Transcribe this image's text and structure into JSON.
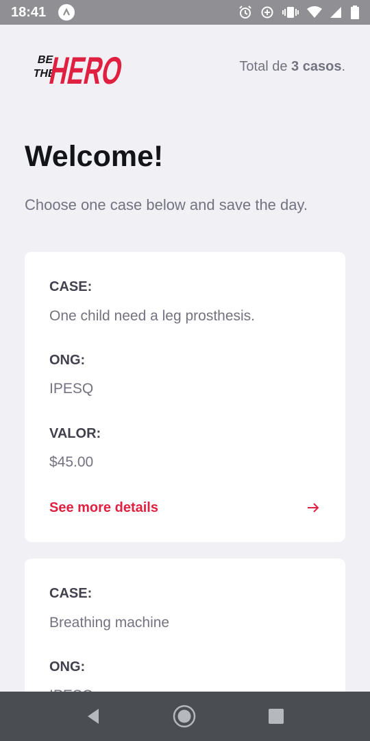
{
  "status_bar": {
    "time": "18:41",
    "icons": [
      "app-notification-icon",
      "alarm-icon",
      "data-saver-icon",
      "vibrate-icon",
      "wifi-icon",
      "signal-icon",
      "battery-icon"
    ]
  },
  "header": {
    "logo_top": "BE",
    "logo_mid": "THE",
    "logo_main": "HERO",
    "total_prefix": "Total de",
    "total_count": "3 casos",
    "total_suffix": "."
  },
  "page": {
    "title": "Welcome!",
    "subtitle": "Choose one case below and save the day."
  },
  "cases": [
    {
      "case_label": "CASE:",
      "case_value": "One child need a leg prosthesis.",
      "ong_label": "ONG:",
      "ong_value": "IPESQ",
      "valor_label": "VALOR:",
      "valor_value": "$45.00",
      "details_label": "See more details"
    },
    {
      "case_label": "CASE:",
      "case_value": "Breathing machine",
      "ong_label": "ONG:",
      "ong_value": "IPESQ"
    }
  ],
  "colors": {
    "brand": "#e02041",
    "background": "#f0f0f5",
    "title": "#13131a",
    "muted": "#737380"
  },
  "nav": {
    "icons": [
      "back-icon",
      "home-icon",
      "recents-icon"
    ]
  }
}
